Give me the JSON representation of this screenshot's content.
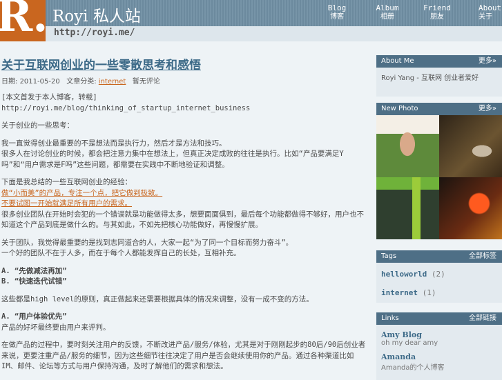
{
  "header": {
    "logo_text": "R.",
    "site_title": "Royi 私人站",
    "site_url": "http://royi.me/",
    "nav": [
      {
        "label": "Blog",
        "sub": "博客"
      },
      {
        "label": "Album",
        "sub": "相册"
      },
      {
        "label": "Friend",
        "sub": "朋友"
      },
      {
        "label": "About",
        "sub": "关于"
      }
    ]
  },
  "post": {
    "title": "关于互联网创业的一些零散思考和感悟",
    "meta": {
      "date_label": "日期:",
      "date": "2011-05-20",
      "category_label": "文章分类:",
      "category": "internet",
      "extra": "暂无评论"
    },
    "paragraphs": [
      {
        "text": "[本文首发于本人博客，转载]",
        "type": "normal"
      },
      {
        "text": "http://royi.me/blog/thinking_of_startup_internet_business",
        "type": "normal"
      },
      {
        "text": "关于创业的一些思考：",
        "type": "normal"
      },
      {
        "text": "我一直觉得创业最重要的不是想法而是执行力，然后才是方法和技巧。",
        "type": "normal"
      },
      {
        "text": "很多人在讨论创业的时候，都会把注意力集中在想法上，但真正决定成败的往往是执行。比如“产品要满足Y吗”和“用户需求是F吗”这些问题，都需要在实践中不断地验证和调整。",
        "type": "normal"
      },
      {
        "text": "下面是我总结的一些互联网创业的经验：",
        "type": "normal"
      },
      {
        "text": "做“小而美”的产品，专注一个点，把它做到极致。",
        "type": "link"
      },
      {
        "text": "不要试图一开始就满足所有用户的需求。",
        "type": "link"
      },
      {
        "text": "很多创业团队在开始时会犯的一个错误就是功能做得太多，想要面面俱到，最后每个功能都做得不够好，用户也不知道这个产品到底是做什么的。与其如此，不如先把核心功能做好，再慢慢扩展。",
        "type": "normal"
      },
      {
        "text": "关于团队，我觉得最重要的是找到志同道合的人，大家一起“为了同一个目标而努力奋斗”。",
        "type": "normal"
      },
      {
        "text": "一个好的团队不在于人多，而在于每个人都能发挥自己的长处，互相补充。",
        "type": "normal"
      },
      {
        "text": "A. “先做减法再加”",
        "type": "bold"
      },
      {
        "text": "B. “快速迭代试错”",
        "type": "bold"
      },
      {
        "text": "这些都是high level的原则，真正做起来还需要根据具体的情况来调整，没有一成不变的方法。",
        "type": "normal"
      },
      {
        "text": "A. “用户体验优先”",
        "type": "bold"
      },
      {
        "text": "产品的好坏最终要由用户来评判。",
        "type": "normal"
      },
      {
        "text": "在做产品的过程中，要时刻关注用户的反馈，不断改进产品/服务/体验，尤其是对于刚刚起步的80后/90后创业者来说，更要注重产品/服务的细节，因为这些细节往往决定了用户是否会继续使用你的产品。通过各种渠道比如IM、邮件、论坛等方式与用户保持沟通，及时了解他们的需求和想法。",
        "type": "normal"
      }
    ]
  },
  "sidebar": {
    "about": {
      "title": "About Me",
      "more": "更多»",
      "text": "Royi Yang - 互联网 创业者爱好"
    },
    "photos": {
      "title": "New Photo",
      "more": "更多»"
    },
    "tags": {
      "title": "Tags",
      "more": "全部标签",
      "items": [
        {
          "name": "helloworld",
          "count": "(2)"
        },
        {
          "name": "internet",
          "count": "(1)"
        }
      ]
    },
    "links": {
      "title": "Links",
      "more": "全部链接",
      "items": [
        {
          "name": "Amy Blog",
          "desc": "oh my dear amy"
        },
        {
          "name": "Amanda",
          "desc": "Amanda的个人博客"
        }
      ]
    }
  }
}
